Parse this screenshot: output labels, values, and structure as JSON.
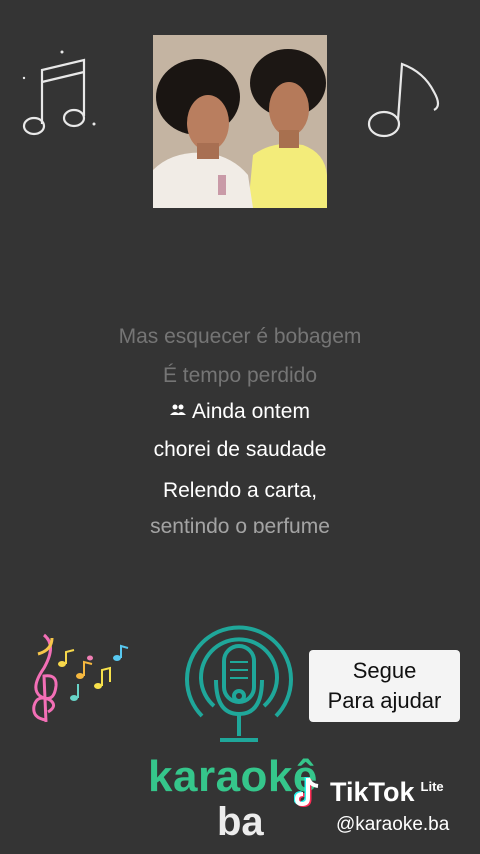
{
  "lyrics": {
    "lines": [
      "Mas esquecer é bobagem",
      "É tempo perdido",
      "Ainda ontem",
      "chorei de saudade",
      "Relendo a carta,",
      "sentindo o perfume"
    ]
  },
  "follow_card": {
    "line1": "Segue",
    "line2": "Para ajudar"
  },
  "brand": {
    "line1": "karaokê",
    "line2": "ba"
  },
  "watermark": {
    "name": "TikTok",
    "badge": "Lite",
    "handle": "@karaoke.ba"
  },
  "colors": {
    "background": "#343434",
    "brand_green": "#35c68b",
    "teal": "#1fa79a"
  },
  "icons": [
    "double-music-note-icon",
    "single-music-note-icon",
    "duet-singers-icon",
    "microphone-logo-icon",
    "colorful-notes-icon",
    "tiktok-logo-icon"
  ]
}
